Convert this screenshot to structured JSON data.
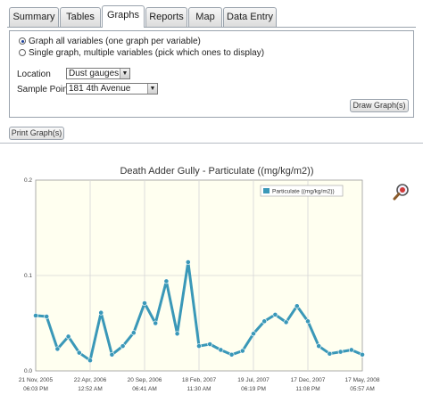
{
  "tabs": [
    {
      "label": "Summary",
      "active": false
    },
    {
      "label": "Tables",
      "active": false
    },
    {
      "label": "Graphs",
      "active": true
    },
    {
      "label": "Reports",
      "active": false
    },
    {
      "label": "Map",
      "active": false
    },
    {
      "label": "Data Entry",
      "active": false
    }
  ],
  "options": {
    "graph_all_label": "Graph all variables (one graph per variable)",
    "single_graph_label": "Single graph, multiple variables (pick which ones to display)",
    "selected": "graph_all"
  },
  "filters": {
    "location_label": "Location",
    "location_value": "Dust gauges",
    "sample_point_label": "Sample Point",
    "sample_point_value": "181 4th Avenue"
  },
  "buttons": {
    "draw_graphs": "Draw Graph(s)",
    "print_graphs": "Print Graph(s)"
  },
  "colors": {
    "series": "#3a98b8",
    "plot_bg": "#fffff0"
  },
  "icons": {
    "zoom": "magnifier-icon"
  },
  "chart_data": {
    "type": "line",
    "title": "Death Adder Gully - Particulate ((mg/kg/m2))",
    "xlabel": "",
    "ylabel": "",
    "ylim": [
      0,
      0.2
    ],
    "yticks": [
      "0.0",
      "0.1",
      "0.2"
    ],
    "xticks": [
      {
        "date": "21 Nov, 2005",
        "time": "06:03 PM"
      },
      {
        "date": "22 Apr, 2006",
        "time": "12:52 AM"
      },
      {
        "date": "20 Sep, 2006",
        "time": "06:41 AM"
      },
      {
        "date": "18 Feb, 2007",
        "time": "11:30 AM"
      },
      {
        "date": "19 Jul, 2007",
        "time": "06:19 PM"
      },
      {
        "date": "17 Dec, 2007",
        "time": "11:08 PM"
      },
      {
        "date": "17 May, 2008",
        "time": "05:57 AM"
      }
    ],
    "grid": true,
    "legend_position": "top-right",
    "series": [
      {
        "name": "Particulate ((mg/kg/m2))",
        "x": [
          "2005-11-21",
          "2005-12-21",
          "2006-01-20",
          "2006-02-19",
          "2006-03-21",
          "2006-04-20",
          "2006-05-20",
          "2006-06-19",
          "2006-07-19",
          "2006-08-18",
          "2006-09-17",
          "2006-10-17",
          "2006-11-16",
          "2006-12-16",
          "2007-01-15",
          "2007-02-14",
          "2007-03-16",
          "2007-04-15",
          "2007-05-15",
          "2007-06-14",
          "2007-07-14",
          "2007-08-13",
          "2007-09-12",
          "2007-10-12",
          "2007-11-11",
          "2007-12-11",
          "2008-01-10",
          "2008-02-09",
          "2008-03-10",
          "2008-04-09",
          "2008-05-09"
        ],
        "values": [
          0.058,
          0.057,
          0.023,
          0.036,
          0.019,
          0.011,
          0.061,
          0.017,
          0.026,
          0.04,
          0.071,
          0.05,
          0.094,
          0.039,
          0.114,
          0.026,
          0.028,
          0.022,
          0.017,
          0.021,
          0.039,
          0.052,
          0.059,
          0.051,
          0.068,
          0.052,
          0.026,
          0.018,
          0.02,
          0.022,
          0.017
        ]
      }
    ]
  }
}
